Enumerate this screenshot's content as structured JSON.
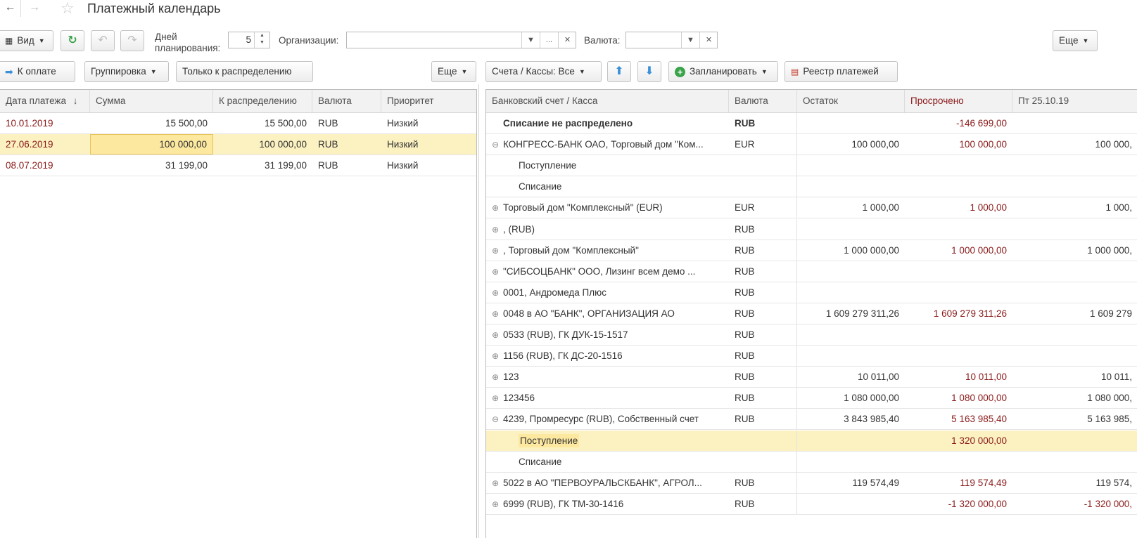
{
  "title": "Платежный календарь",
  "toolbar": {
    "view_label": "Вид",
    "days_label_1": "Дней",
    "days_label_2": "планирования:",
    "days_value": "5",
    "org_label": "Организации:",
    "org_value": "",
    "currency_label": "Валюта:",
    "currency_value": "",
    "more_label": "Еще",
    "select_btn": "..."
  },
  "left_toolbar": {
    "to_pay": "К оплате",
    "grouping": "Группировка",
    "only_distribute": "Только к распределению",
    "more": "Еще"
  },
  "right_toolbar": {
    "accounts": "Счета / Кассы: Все",
    "plan": "Запланировать",
    "registry": "Реестр платежей"
  },
  "left_table": {
    "headers": [
      "Дата платежа",
      "Сумма",
      "К распределению",
      "Валюта",
      "Приоритет"
    ],
    "sort_indicator": "↓",
    "rows": [
      {
        "date": "10.01.2019",
        "sum": "15 500,00",
        "distribute": "15 500,00",
        "currency": "RUB",
        "priority": "Низкий"
      },
      {
        "date": "27.06.2019",
        "sum": "100 000,00",
        "distribute": "100 000,00",
        "currency": "RUB",
        "priority": "Низкий"
      },
      {
        "date": "08.07.2019",
        "sum": "31 199,00",
        "distribute": "31 199,00",
        "currency": "RUB",
        "priority": "Низкий"
      }
    ]
  },
  "right_table": {
    "headers": [
      "Банковский счет / Касса",
      "Валюта",
      "Остаток",
      "Просрочено",
      "Пт 25.10.19"
    ],
    "rows": [
      {
        "name": "Списание не распределено",
        "currency": "RUB",
        "balance": "",
        "overdue": "-146 699,00",
        "day": "",
        "expander": "",
        "indent": 0,
        "bold": true
      },
      {
        "name": "КОНГРЕСС-БАНК ОАО, Торговый дом \"Ком...",
        "currency": "EUR",
        "balance": "100 000,00",
        "overdue": "100 000,00",
        "day": "100 000,",
        "expander": "⊖",
        "indent": 0
      },
      {
        "name": "Поступление",
        "currency": "",
        "balance": "",
        "overdue": "",
        "day": "",
        "expander": "",
        "indent": 1
      },
      {
        "name": "Списание",
        "currency": "",
        "balance": "",
        "overdue": "",
        "day": "",
        "expander": "",
        "indent": 1
      },
      {
        "name": "Торговый дом \"Комплексный\" (EUR)",
        "currency": "EUR",
        "balance": "1 000,00",
        "overdue": "1 000,00",
        "day": "1 000,",
        "expander": "⊕",
        "indent": 0
      },
      {
        "name": ",  (RUB)",
        "currency": "RUB",
        "balance": "",
        "overdue": "",
        "day": "",
        "expander": "⊕",
        "indent": 0
      },
      {
        "name": ", Торговый дом \"Комплексный\"",
        "currency": "RUB",
        "balance": "1 000 000,00",
        "overdue": "1 000 000,00",
        "day": "1 000 000,",
        "expander": "⊕",
        "indent": 0
      },
      {
        "name": "\"СИБСОЦБАНК\" ООО, Лизинг всем демо ...",
        "currency": "RUB",
        "balance": "",
        "overdue": "",
        "day": "",
        "expander": "⊕",
        "indent": 0
      },
      {
        "name": "0001, Андромеда Плюс",
        "currency": "RUB",
        "balance": "",
        "overdue": "",
        "day": "",
        "expander": "⊕",
        "indent": 0
      },
      {
        "name": "0048 в АО \"БАНК\", ОРГАНИЗАЦИЯ АО",
        "currency": "RUB",
        "balance": "1 609 279 311,26",
        "overdue": "1 609 279 311,26",
        "day": "1 609 279",
        "expander": "⊕",
        "indent": 0
      },
      {
        "name": "0533 (RUB), ГК ДУК-15-1517",
        "currency": "RUB",
        "balance": "",
        "overdue": "",
        "day": "",
        "expander": "⊕",
        "indent": 0
      },
      {
        "name": "1156 (RUB), ГК ДС-20-1516",
        "currency": "RUB",
        "balance": "",
        "overdue": "",
        "day": "",
        "expander": "⊕",
        "indent": 0
      },
      {
        "name": "123",
        "currency": "RUB",
        "balance": "10 011,00",
        "overdue": "10 011,00",
        "day": "10 011,",
        "expander": "⊕",
        "indent": 0
      },
      {
        "name": "123456",
        "currency": "RUB",
        "balance": "1 080 000,00",
        "overdue": "1 080 000,00",
        "day": "1 080 000,",
        "expander": "⊕",
        "indent": 0
      },
      {
        "name": "4239, Промресурс (RUB), Собственный счет",
        "currency": "RUB",
        "balance": "3 843 985,40",
        "overdue": "5 163 985,40",
        "day": "5 163 985,",
        "expander": "⊖",
        "indent": 0
      },
      {
        "name": "Поступление",
        "currency": "",
        "balance": "",
        "overdue": "1 320 000,00",
        "day": "",
        "expander": "",
        "indent": 1,
        "selected": true
      },
      {
        "name": "Списание",
        "currency": "",
        "balance": "",
        "overdue": "",
        "day": "",
        "expander": "",
        "indent": 1
      },
      {
        "name": "5022 в АО \"ПЕРВОУРАЛЬСКБАНК\", АГРОЛ...",
        "currency": "RUB",
        "balance": "119 574,49",
        "overdue": "119 574,49",
        "day": "119 574,",
        "expander": "⊕",
        "indent": 0
      },
      {
        "name": "6999 (RUB), ГК ТМ-30-1416",
        "currency": "RUB",
        "balance": "",
        "overdue": "-1 320 000,00",
        "day": "-1 320 000,",
        "expander": "⊕",
        "indent": 0
      }
    ]
  },
  "colors": {
    "selected_row": "#fbf1c1",
    "focus_cell": "#fde8a0",
    "negative_text": "#8b1a1a",
    "accent_green": "#3aa34a",
    "accent_blue": "#3a8fd9"
  }
}
